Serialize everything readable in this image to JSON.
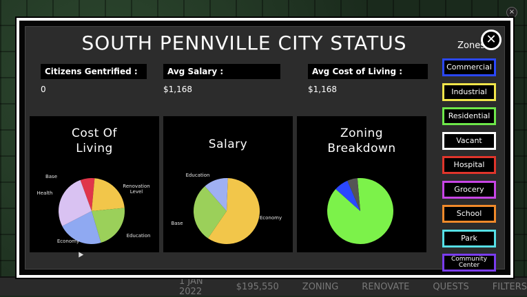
{
  "title": "SOUTH PENNVILLE CITY STATUS",
  "zones_label": "Zones",
  "stats": [
    {
      "label": "Citizens Gentrified :",
      "value": "0"
    },
    {
      "label": "Avg Salary :",
      "value": "$1,168"
    },
    {
      "label": "Avg Cost of Living :",
      "value": "$1,168"
    }
  ],
  "bottom_bar": {
    "date": "1 JAN 2022",
    "money": "$195,550",
    "zoning": "ZONING",
    "renovate": "RENOVATE",
    "quests": "QUESTS",
    "filters": "FILTERS"
  },
  "zones": [
    {
      "label": "Commercial",
      "color": "#2b48ff"
    },
    {
      "label": "Industrial",
      "color": "#f2e64a"
    },
    {
      "label": "Residential",
      "color": "#6ee84a"
    },
    {
      "label": "Vacant",
      "color": "#ffffff"
    },
    {
      "label": "Hospital",
      "color": "#e0352b"
    },
    {
      "label": "Grocery",
      "color": "#c845e6"
    },
    {
      "label": "School",
      "color": "#f08a2a"
    },
    {
      "label": "Park",
      "color": "#56e0e6"
    },
    {
      "label": "Community Center",
      "color": "#7a3cf0"
    }
  ],
  "chart_data": [
    {
      "type": "pie",
      "title": "Cost Of Living",
      "series": [
        {
          "name": "Base",
          "value": 7,
          "color": "#e0354a"
        },
        {
          "name": "Renovation Level",
          "value": 22,
          "color": "#f2c64a"
        },
        {
          "name": "Education",
          "value": 22,
          "color": "#9bd05a"
        },
        {
          "name": "Economy",
          "value": 22,
          "color": "#8fa9f2"
        },
        {
          "name": "Health",
          "value": 27,
          "color": "#d9c2f2"
        }
      ]
    },
    {
      "type": "pie",
      "title": "Salary",
      "series": [
        {
          "name": "Education",
          "value": 59,
          "color": "#f2c64a"
        },
        {
          "name": "Economy",
          "value": 29,
          "color": "#9bd05a"
        },
        {
          "name": "Base",
          "value": 12,
          "color": "#9fb0f2"
        }
      ]
    },
    {
      "type": "pie",
      "title": "Zoning Breakdown",
      "series": [
        {
          "name": "Residential",
          "value": 88,
          "color": "#7cf24a"
        },
        {
          "name": "Commercial",
          "value": 7,
          "color": "#2b48ff"
        },
        {
          "name": "Vacant",
          "value": 5,
          "color": "#555555"
        }
      ]
    }
  ]
}
